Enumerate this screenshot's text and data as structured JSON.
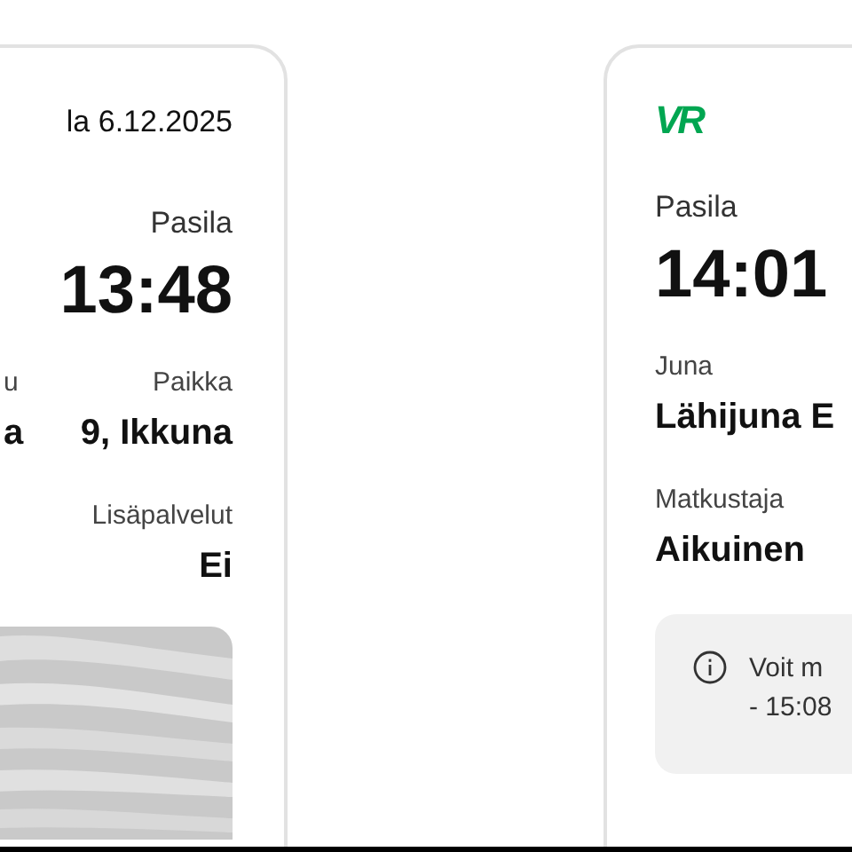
{
  "left_ticket": {
    "date": "la 6.12.2025",
    "station": "Pasila",
    "time": "13:48",
    "columns": [
      {
        "label": "u",
        "value": "a"
      },
      {
        "label": "Paikka",
        "value": "9, Ikkuna"
      }
    ],
    "services": {
      "label": "Lisäpalvelut",
      "value": "Ei"
    }
  },
  "right_ticket": {
    "logo": "VR",
    "station": "Pasila",
    "time": "14:01",
    "fields": [
      {
        "label": "Juna",
        "value": "Lähijuna E"
      },
      {
        "label": "Matkustaja",
        "value": "Aikuinen"
      }
    ],
    "notice": {
      "lines": [
        "Voit m",
        "- 15:08"
      ]
    }
  }
}
